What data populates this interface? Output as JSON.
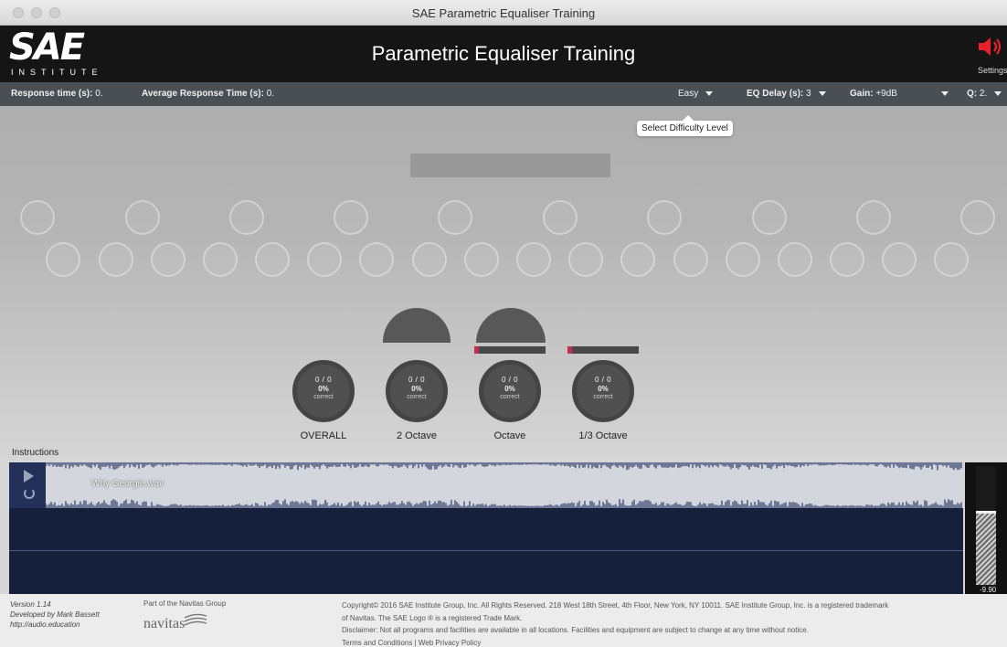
{
  "window": {
    "title": "SAE Parametric Equaliser Training"
  },
  "header": {
    "logo_main": "SAE",
    "logo_sub": "INSTITUTE",
    "title": "Parametric Equaliser Training",
    "settings_label": "Settings",
    "speaker_color": "#e8212b"
  },
  "statusbar": {
    "response_label": "Response time (s):",
    "response_value": "0.",
    "avg_label": "Average Response Time (s):",
    "avg_value": "0.",
    "difficulty": "Easy",
    "eq_delay_label": "EQ Delay (s):",
    "eq_delay_value": "3",
    "gain_label": "Gain:",
    "gain_value": "+9dB",
    "q_label": "Q:",
    "q_value": "2."
  },
  "tooltip": "Select Difficulty Level",
  "scores": [
    {
      "fraction": "0 / 0",
      "percent": "0%",
      "correct": "correct",
      "label": "OVERALL"
    },
    {
      "fraction": "0 / 0",
      "percent": "0%",
      "correct": "correct",
      "label": "2 Octave"
    },
    {
      "fraction": "0 / 0",
      "percent": "0%",
      "correct": "correct",
      "label": "Octave"
    },
    {
      "fraction": "0 / 0",
      "percent": "0%",
      "correct": "correct",
      "label": "1/3 Octave"
    }
  ],
  "instructions_label": "Instructions",
  "player": {
    "filename": "Why Georgie.wav",
    "meter_readout": "-9.90"
  },
  "footer": {
    "version": "Version 1.14",
    "developer": "Developed by Mark Bassett",
    "url": "http://audio.education",
    "group": "Part of the Navitas Group",
    "navitas": "navitas",
    "copyright": "Copyright© 2016 SAE Institute Group, Inc. All Rights Reserved. 218 West 18th Street, 4th Floor, New York, NY 10011. SAE Institute Group, Inc. is a registered trademark",
    "trademark": "of Navitas. The SAE Logo ® is a registered Trade Mark.",
    "disclaimer": "Disclaimer: Not all programs and facilities are available in all locations. Facilities and equipment are subject to change at any time without notice.",
    "links": "Terms and Conditions | Web Privacy Policy"
  }
}
